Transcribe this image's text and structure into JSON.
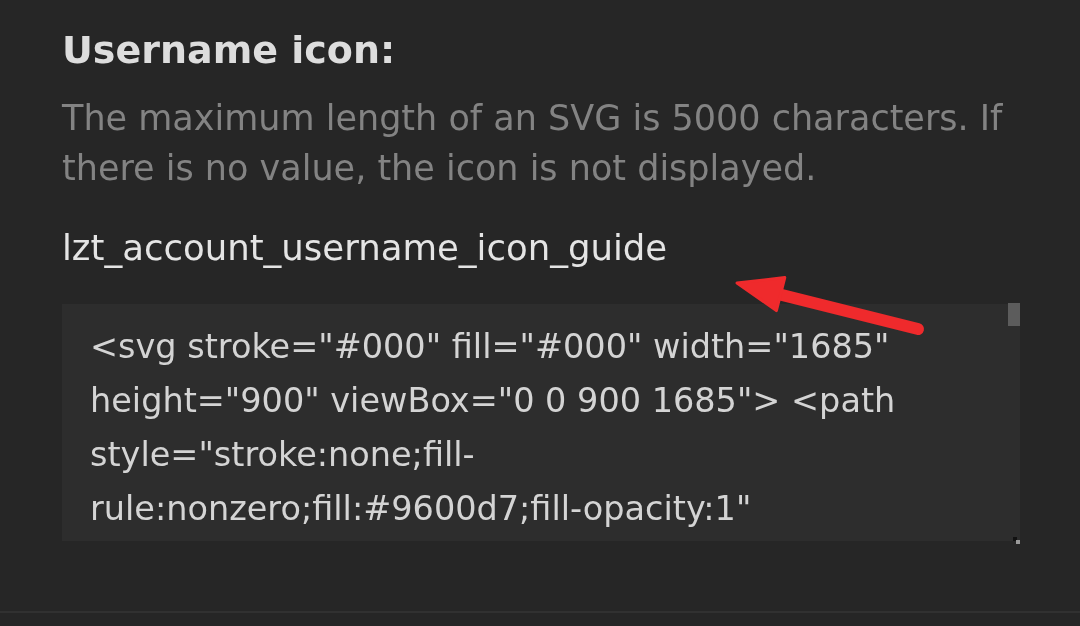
{
  "section": {
    "title": "Username icon:",
    "description": "The maximum length of an SVG is 5000 characters. If there is no value, the icon is not displayed.",
    "field_label": "lzt_account_username_icon_guide",
    "field": {
      "value": "<svg stroke=\"#000\" fill=\"#000\" width=\"1685\" height=\"900\" viewBox=\"0 0 900 1685\"> <path style=\"stroke:none;fill-rule:nonzero;fill:#9600d7;fill-opacity:1\""
    }
  }
}
